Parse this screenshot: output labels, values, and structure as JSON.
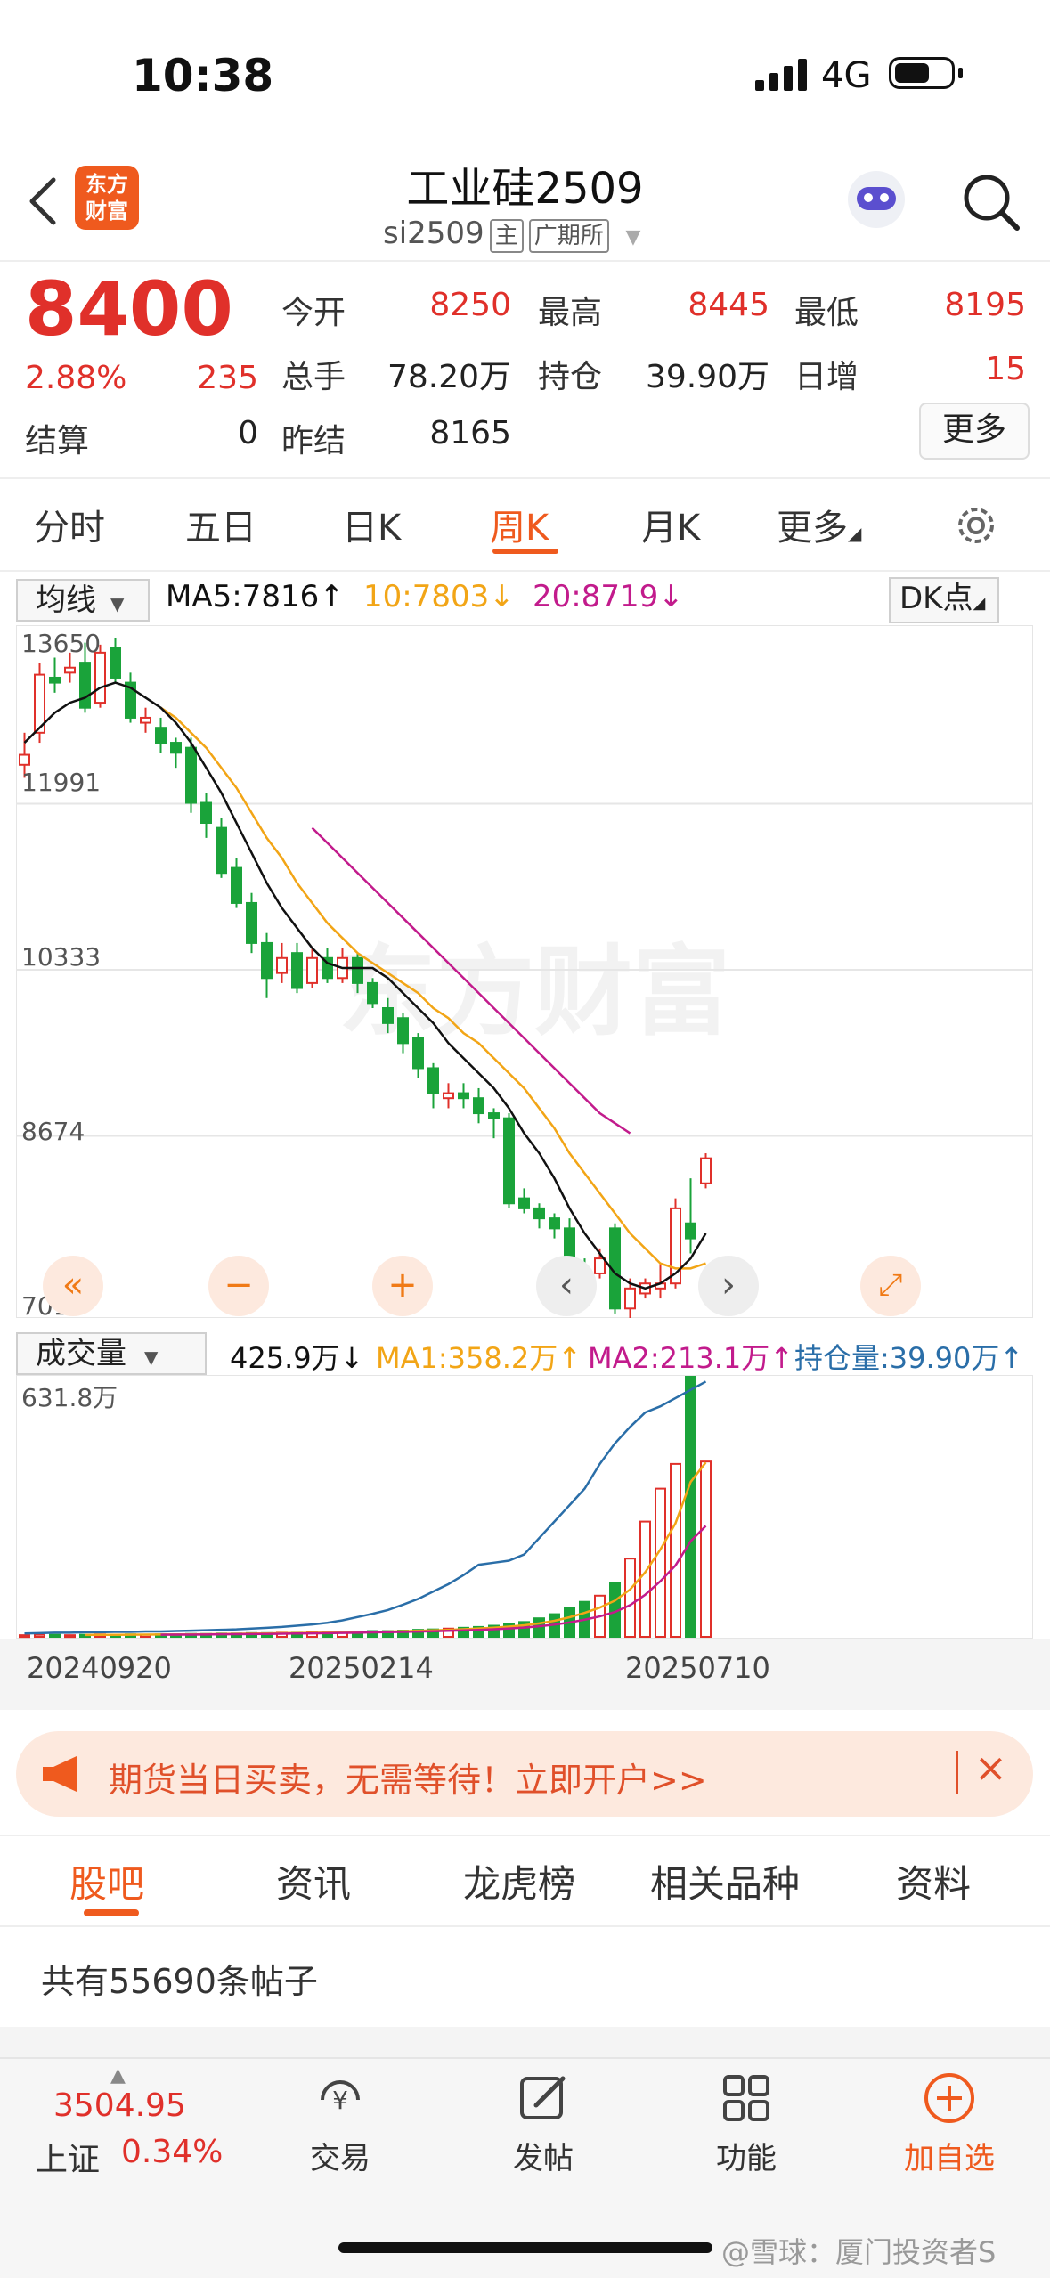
{
  "status_bar": {
    "time": "10:38",
    "network": "4G"
  },
  "header": {
    "logo_line1": "东方",
    "logo_line2": "财富",
    "title": "工业硅2509",
    "code": "si2509",
    "tag_main": "主",
    "tag_exchange": "广期所"
  },
  "quote": {
    "price": "8400",
    "change_pct": "2.88%",
    "change": "235",
    "open_label": "今开",
    "open": "8250",
    "high_label": "最高",
    "high": "8445",
    "low_label": "最低",
    "low": "8195",
    "volume_label": "总手",
    "volume": "78.20万",
    "position_label": "持仓",
    "position": "39.90万",
    "daily_inc_label": "日增",
    "daily_inc": "15",
    "settle_label": "结算",
    "settle": "0",
    "prev_settle_label": "昨结",
    "prev_settle": "8165",
    "more_button": "更多"
  },
  "period_tabs": [
    "分时",
    "五日",
    "日K",
    "周K",
    "月K",
    "更多"
  ],
  "active_period": "周K",
  "indicators": {
    "ma_selector": "均线",
    "ma5": "MA5:7816↑",
    "ma10": "10:7803↓",
    "ma20": "20:8719↓",
    "dk_button": "DK点",
    "vol_selector": "成交量",
    "vol_value": "425.9万↓",
    "vol_ma1": "MA1:358.2万↑",
    "vol_ma2": "MA2:213.1万↑",
    "open_interest": "持仓量:39.90万↑"
  },
  "chart_data": {
    "type": "candlestick",
    "y_ticks": [
      "13650",
      "11991",
      "10333",
      "8674",
      "7015"
    ],
    "ylim": [
      7015,
      13650
    ],
    "volume_max_label": "631.8万",
    "x_labels": [
      "20240920",
      "20250214",
      "20250710"
    ],
    "candles": [
      {
        "o": 12380,
        "c": 12480,
        "h": 12700,
        "l": 12250
      },
      {
        "o": 12700,
        "c": 13280,
        "h": 13400,
        "l": 12600
      },
      {
        "o": 13250,
        "c": 13200,
        "h": 13450,
        "l": 13100
      },
      {
        "o": 13300,
        "c": 13350,
        "h": 13500,
        "l": 13200
      },
      {
        "o": 13400,
        "c": 12950,
        "h": 13600,
        "l": 12900
      },
      {
        "o": 13000,
        "c": 13500,
        "h": 13580,
        "l": 12950
      },
      {
        "o": 13550,
        "c": 13250,
        "h": 13650,
        "l": 13200
      },
      {
        "o": 13200,
        "c": 12850,
        "h": 13300,
        "l": 12800
      },
      {
        "o": 12800,
        "c": 12850,
        "h": 12950,
        "l": 12700
      },
      {
        "o": 12750,
        "c": 12600,
        "h": 12850,
        "l": 12500
      },
      {
        "o": 12600,
        "c": 12500,
        "h": 12650,
        "l": 12350
      },
      {
        "o": 12550,
        "c": 12000,
        "h": 12650,
        "l": 11900
      },
      {
        "o": 12000,
        "c": 11800,
        "h": 12100,
        "l": 11650
      },
      {
        "o": 11750,
        "c": 11300,
        "h": 11850,
        "l": 11250
      },
      {
        "o": 11350,
        "c": 11000,
        "h": 11450,
        "l": 10950
      },
      {
        "o": 11000,
        "c": 10600,
        "h": 11100,
        "l": 10500
      },
      {
        "o": 10600,
        "c": 10250,
        "h": 10700,
        "l": 10050
      },
      {
        "o": 10300,
        "c": 10450,
        "h": 10600,
        "l": 10200
      },
      {
        "o": 10500,
        "c": 10150,
        "h": 10600,
        "l": 10100
      },
      {
        "o": 10200,
        "c": 10450,
        "h": 10550,
        "l": 10150
      },
      {
        "o": 10450,
        "c": 10250,
        "h": 10550,
        "l": 10200
      },
      {
        "o": 10250,
        "c": 10450,
        "h": 10550,
        "l": 10200
      },
      {
        "o": 10450,
        "c": 10200,
        "h": 10500,
        "l": 10100
      },
      {
        "o": 10200,
        "c": 10000,
        "h": 10250,
        "l": 9950
      },
      {
        "o": 9950,
        "c": 9800,
        "h": 10050,
        "l": 9700
      },
      {
        "o": 9850,
        "c": 9600,
        "h": 9900,
        "l": 9500
      },
      {
        "o": 9650,
        "c": 9350,
        "h": 9700,
        "l": 9250
      },
      {
        "o": 9350,
        "c": 9100,
        "h": 9400,
        "l": 8950
      },
      {
        "o": 9050,
        "c": 9100,
        "h": 9200,
        "l": 8950
      },
      {
        "o": 9100,
        "c": 9050,
        "h": 9200,
        "l": 8950
      },
      {
        "o": 9050,
        "c": 8900,
        "h": 9150,
        "l": 8800
      },
      {
        "o": 8900,
        "c": 8850,
        "h": 8950,
        "l": 8650
      },
      {
        "o": 8850,
        "c": 8000,
        "h": 8900,
        "l": 7950
      },
      {
        "o": 8050,
        "c": 7950,
        "h": 8150,
        "l": 7900
      },
      {
        "o": 7950,
        "c": 7850,
        "h": 8000,
        "l": 7750
      },
      {
        "o": 7850,
        "c": 7750,
        "h": 7900,
        "l": 7650
      },
      {
        "o": 7750,
        "c": 7350,
        "h": 7850,
        "l": 7150
      },
      {
        "o": 7350,
        "c": 7250,
        "h": 7450,
        "l": 7100
      },
      {
        "o": 7300,
        "c": 7450,
        "h": 7550,
        "l": 7250
      },
      {
        "o": 7750,
        "c": 6950,
        "h": 7800,
        "l": 6900
      },
      {
        "o": 6950,
        "c": 7150,
        "h": 7250,
        "l": 6850
      },
      {
        "o": 7100,
        "c": 7200,
        "h": 7250,
        "l": 7050
      },
      {
        "o": 7150,
        "c": 7200,
        "h": 7400,
        "l": 7050
      },
      {
        "o": 7200,
        "c": 7950,
        "h": 8050,
        "l": 7150
      },
      {
        "o": 7800,
        "c": 7650,
        "h": 8250,
        "l": 7500
      },
      {
        "o": 8200,
        "c": 8450,
        "h": 8500,
        "l": 8150
      }
    ],
    "ma5": [
      12600,
      12750,
      12900,
      13000,
      13050,
      13150,
      13200,
      13150,
      13050,
      12950,
      12800,
      12600,
      12350,
      12100,
      11800,
      11500,
      11200,
      10950,
      10750,
      10550,
      10400,
      10350,
      10350,
      10350,
      10250,
      10100,
      9950,
      9800,
      9600,
      9450,
      9300,
      9150,
      8950,
      8700,
      8500,
      8250,
      7950,
      7700,
      7500,
      7300,
      7200,
      7150,
      7200,
      7300,
      7450,
      7700
    ],
    "ma10": [
      null,
      null,
      null,
      null,
      null,
      null,
      null,
      null,
      null,
      12950,
      12850,
      12700,
      12550,
      12350,
      12150,
      11900,
      11650,
      11450,
      11200,
      11000,
      10800,
      10650,
      10500,
      10400,
      10300,
      10200,
      10100,
      9950,
      9850,
      9700,
      9600,
      9450,
      9300,
      9150,
      8950,
      8750,
      8500,
      8300,
      8100,
      7900,
      7700,
      7550,
      7400,
      7350,
      7350,
      7400
    ],
    "ma20": [
      null,
      null,
      null,
      null,
      null,
      null,
      null,
      null,
      null,
      null,
      null,
      null,
      null,
      null,
      null,
      null,
      null,
      null,
      null,
      11750,
      11600,
      11450,
      11300,
      11150,
      11000,
      10850,
      10700,
      10550,
      10400,
      10250,
      10100,
      9950,
      9800,
      9650,
      9500,
      9350,
      9200,
      9050,
      8900,
      8800,
      8700,
      null,
      null,
      null,
      null,
      null
    ],
    "volume_max": 631.8,
    "volumes": [
      4,
      5,
      5,
      4,
      5,
      6,
      5,
      6,
      5,
      6,
      6,
      7,
      7,
      8,
      8,
      9,
      9,
      10,
      10,
      11,
      11,
      12,
      13,
      14,
      14,
      15,
      17,
      18,
      20,
      22,
      24,
      27,
      32,
      36,
      45,
      55,
      70,
      85,
      100,
      130,
      190,
      280,
      360,
      420,
      631.8,
      425.9
    ],
    "open_interest": [
      8,
      9,
      10,
      10,
      11,
      11,
      12,
      12,
      13,
      13,
      14,
      15,
      16,
      17,
      18,
      20,
      22,
      24,
      27,
      30,
      34,
      40,
      48,
      56,
      65,
      78,
      92,
      110,
      128,
      150,
      175,
      180,
      185,
      200,
      240,
      280,
      320,
      360,
      420,
      470,
      510,
      545,
      560,
      580,
      600,
      620
    ]
  },
  "controls": {
    "fast_back": "«",
    "zoom_out": "−",
    "zoom_in": "+",
    "prev": "‹",
    "next": "›",
    "expand": "⤢"
  },
  "banner": {
    "text": "期货当日买卖，无需等待！立即开户>>",
    "close": "×"
  },
  "content_tabs": [
    "股吧",
    "资讯",
    "龙虎榜",
    "相关品种",
    "资料"
  ],
  "active_content_tab": "股吧",
  "post_count": "共有55690条帖子",
  "bottom_nav": {
    "index_value": "3504.95",
    "index_name": "上证",
    "index_change": "0.34%",
    "trade": "交易",
    "post": "发帖",
    "function": "功能",
    "add_watch": "加自选"
  },
  "watermark": "@雪球：厦门投资者S",
  "chart_watermark": "东方财富",
  "colors": {
    "up": "#e0302a",
    "down": "#1aa33a",
    "ma5": "#111111",
    "ma10": "#f2a516",
    "ma20": "#c21b8c",
    "oi": "#2a6ea8",
    "brand": "#ef5a1e"
  }
}
